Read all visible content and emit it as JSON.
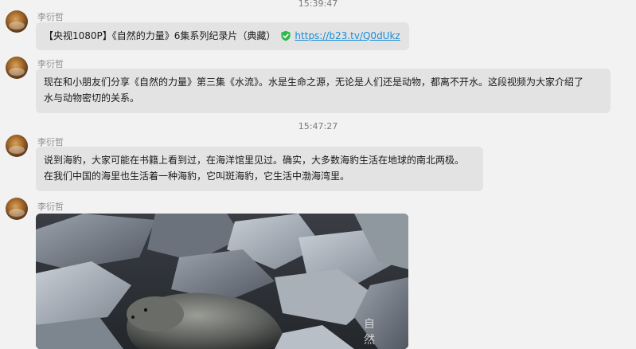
{
  "messages": [
    {
      "timestamp": "15:39:47",
      "sender": "李衍哲",
      "text_prefix": "【央视1080P】《自然的力量》6集系列纪录片（典藏）",
      "link": "https://b23.tv/Q0dUkz",
      "icon": "verified-shield-icon"
    },
    {
      "sender": "李衍哲",
      "lines": [
        "现在和小朋友们分享《自然的力量》第三集《水流》。水是生命之源，无论是人们还是动物，都离不开水。这段视频为大家介绍了",
        "水与动物密切的关系。"
      ]
    },
    {
      "timestamp": "15:47:27",
      "sender": "李衍哲",
      "lines": [
        "说到海豹，大家可能在书籍上看到过，在海洋馆里见过。确实，大多数海豹生活在地球的南北两极。",
        "在我们中国的海里也生活着一种海豹，它叫斑海豹，它生活中渤海湾里。"
      ]
    },
    {
      "sender": "李衍哲",
      "image": {
        "watermark_line1": "自",
        "watermark_line2": "然"
      }
    }
  ],
  "colors": {
    "background": "#f2f2f2",
    "bubble": "#e3e3e3",
    "link": "#1a8cd8",
    "shield": "#2db84d"
  }
}
